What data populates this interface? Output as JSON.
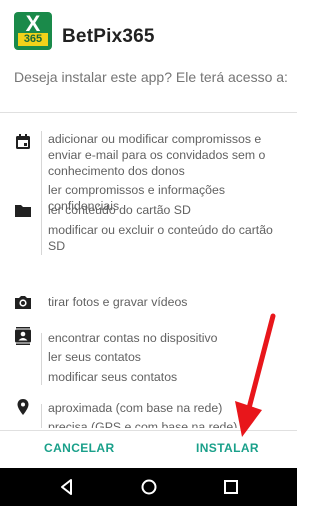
{
  "app": {
    "icon_text": "X",
    "icon_number": "365",
    "name": "BetPix365"
  },
  "question": "Deseja instalar este app? Ele terá acesso a:",
  "permission_groups": [
    {
      "icon": "calendar-icon",
      "items": [
        "adicionar ou modificar compromissos e enviar e-mail para os convidados sem o conhecimento dos donos",
        "ler compromissos e informações confidenciais"
      ]
    },
    {
      "icon": "folder-icon",
      "items": [
        "ler conteúdo do cartão SD",
        "modificar ou excluir o conteúdo do cartão SD"
      ]
    },
    {
      "icon": "camera-icon",
      "items": [
        "tirar fotos e gravar vídeos"
      ]
    },
    {
      "icon": "contacts-icon",
      "items": [
        "encontrar contas no dispositivo",
        "ler seus contatos",
        "modificar seus contatos"
      ]
    },
    {
      "icon": "location-icon",
      "items": [
        "aproximada (com base na rede)",
        "precisa (GPS e com base na rede)"
      ]
    }
  ],
  "buttons": {
    "cancel": "CANCELAR",
    "install": "INSTALAR"
  },
  "colors": {
    "accent": "#1aa08a",
    "annotation_arrow": "#e8161b",
    "app_icon_bg": "#1a8a4a",
    "app_icon_badge": "#f2d21a"
  }
}
